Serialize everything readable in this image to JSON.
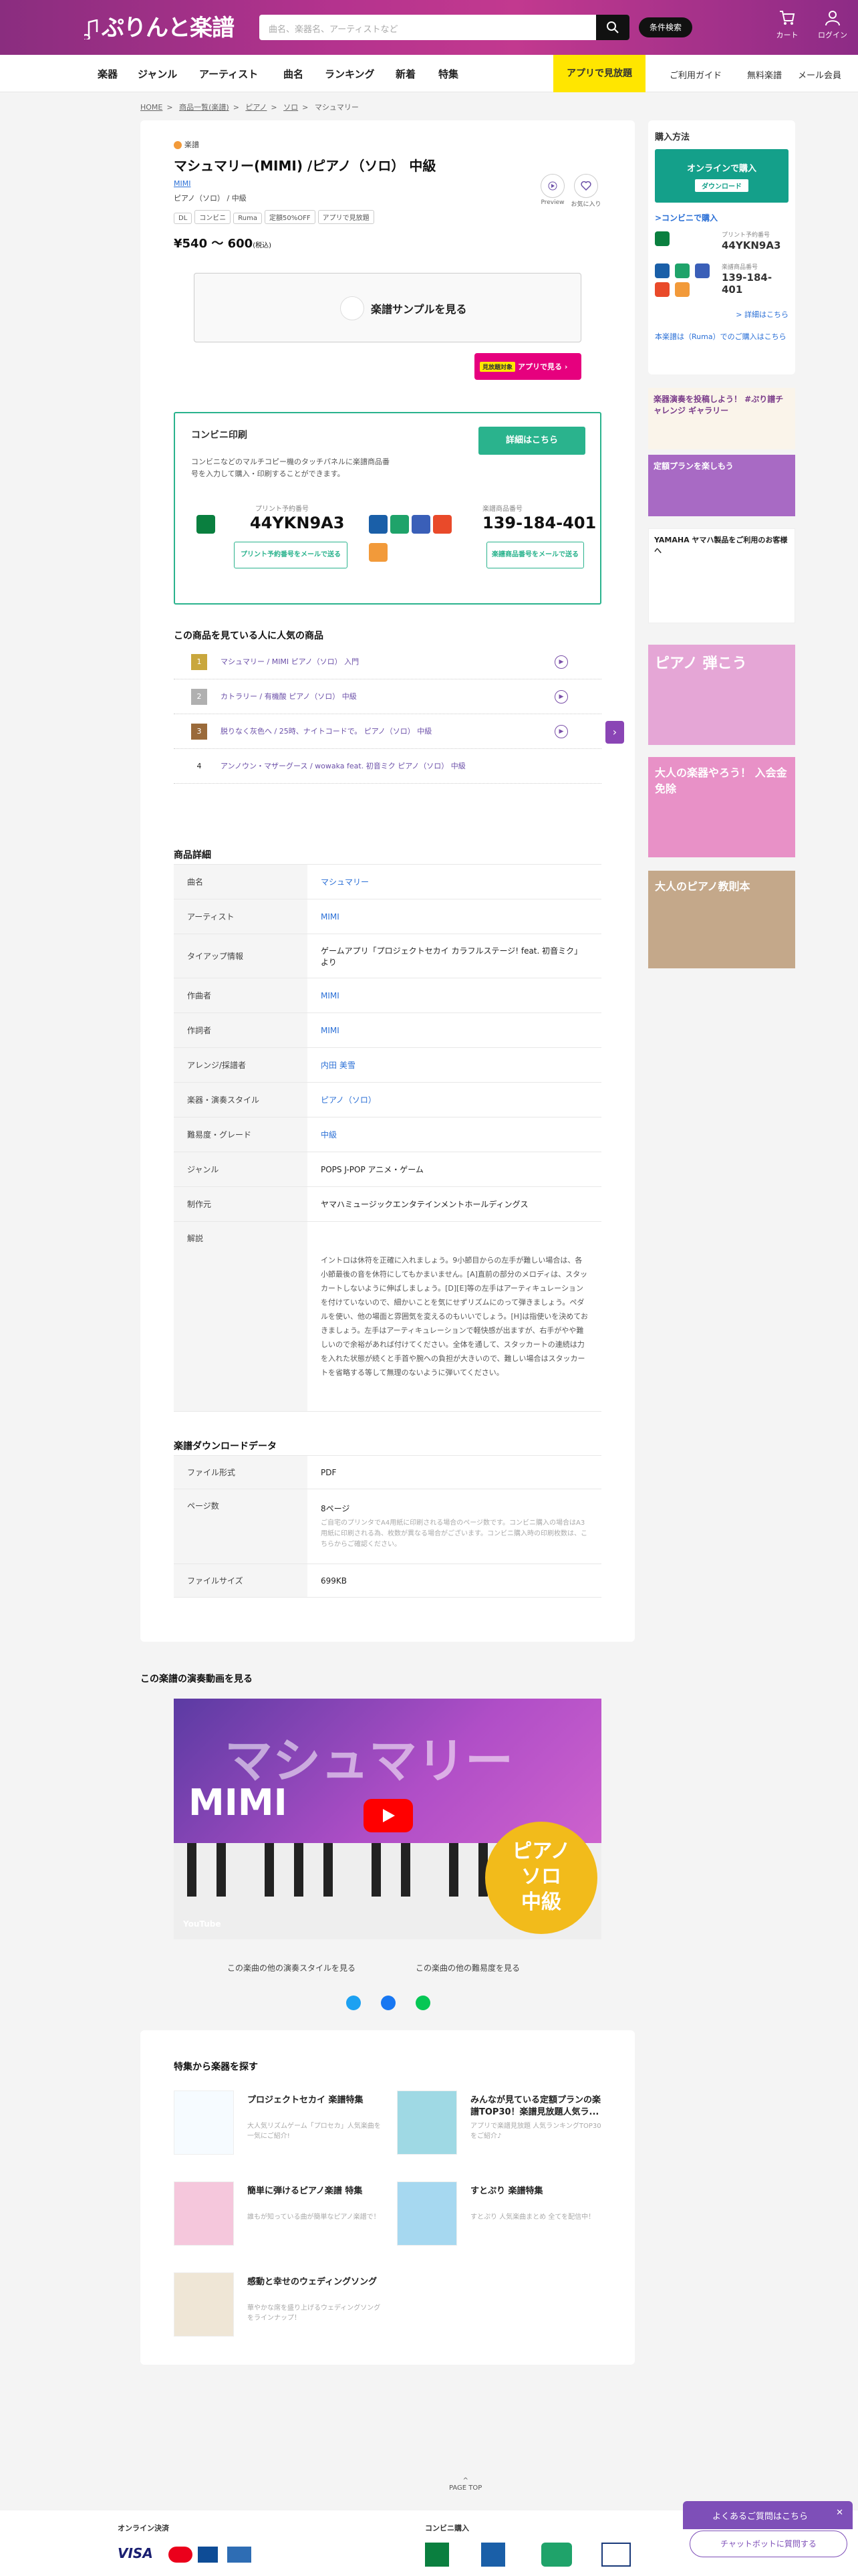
{
  "header": {
    "logo": "ぷりんと楽譜",
    "search_placeholder": "曲名、楽器名、アーティストなど",
    "condition_search": "条件検索",
    "cart": "カート",
    "login": "ログイン"
  },
  "nav": {
    "items": [
      "楽器",
      "ジャンル",
      "アーティスト",
      "曲名",
      "ランキング",
      "新着",
      "特集"
    ],
    "app": "アプリで見放題",
    "right": [
      "ご利用ガイド",
      "無料楽譜",
      "メール会員"
    ]
  },
  "breadcrumb": [
    "HOME",
    "商品一覧(楽譜)",
    "ピアノ",
    "ソロ",
    "マシュマリー"
  ],
  "product": {
    "category": "楽譜",
    "title": "マシュマリー(MIMI) /ピアノ（ソロ） 中級",
    "artist": "MIMI",
    "instrument": "ピアノ（ソロ） / 中級",
    "tags": [
      "DL",
      "コンビニ",
      "Ruma",
      "定額50%OFF",
      "アプリで見放題"
    ],
    "price": "¥540 〜 600",
    "tax": "(税込)",
    "favorite": "お気に入り",
    "preview": "Preview",
    "sample": "楽譜サンプルを見る",
    "app_badge": "見放題対象",
    "app_button": "アプリで見る"
  },
  "convenience": {
    "heading": "コンビニ印刷",
    "desc": "コンビニなどのマルチコピー機のタッチパネルに楽譜商品番号を入力して購入・印刷することができます。",
    "more": "詳細はこちら",
    "print_label": "プリント予約番号",
    "print_code": "44YKN9A3",
    "product_label": "楽譜商品番号",
    "product_code": "139-184-401",
    "mail1": "プリント予約番号をメールで送る",
    "mail2": "楽譜商品番号をメールで送る"
  },
  "popular": {
    "heading": "この商品を見ている人に人気の商品",
    "items": [
      {
        "rank": "1",
        "title": "マシュマリー / MIMI ピアノ（ソロ） 入門"
      },
      {
        "rank": "2",
        "title": "カトラリー / 有機酸 ピアノ（ソロ） 中級"
      },
      {
        "rank": "3",
        "title": "脱りなく灰色へ / 25時、ナイトコードで。 ピアノ（ソロ） 中級"
      },
      {
        "rank": "4",
        "title": "アンノウン・マザーグース / wowaka feat. 初音ミク ピアノ（ソロ） 中級"
      }
    ]
  },
  "details": {
    "heading": "商品詳細",
    "rows": [
      {
        "k": "曲名",
        "v": "マシュマリー"
      },
      {
        "k": "アーティスト",
        "v": "MIMI"
      },
      {
        "k": "タイアップ情報",
        "v": "ゲームアプリ「プロジェクトセカイ カラフルステージ! feat. 初音ミク」より"
      },
      {
        "k": "作曲者",
        "v": "MIMI"
      },
      {
        "k": "作詞者",
        "v": "MIMI"
      },
      {
        "k": "アレンジ/採譜者",
        "v": "内田 美雪"
      },
      {
        "k": "楽器・演奏スタイル",
        "v": "ピアノ（ソロ）"
      },
      {
        "k": "難易度・グレード",
        "v": "中級"
      },
      {
        "k": "ジャンル",
        "v": "POPS J-POP アニメ・ゲーム"
      },
      {
        "k": "制作元",
        "v": "ヤマハミュージックエンタテインメントホールディングス"
      },
      {
        "k": "解説",
        "v": "イントロは休符を正確に入れましょう。9小節目からの左手が難しい場合は、各小節最後の音を休符にしてもかまいません。[A]直前の部分のメロディは、スタッカートしないように伸ばしましょう。[D][E]等の左手はアーティキュレーションを付けていないので、細かいことを気にせずリズムにのって弾きましょう。ペダルを使い、他の場面と雰囲気を変えるのもいいでしょう。[H]は指使いを決めておきましょう。左手はアーティキュレーションで軽快感が出ますが、右手がやや難しいので余裕があれば付けてください。全体を通して、スタッカートの連続は力を入れた状態が続くと手首や腕への負担が大きいので、難しい場合はスタッカートを省略する等して無理のないように弾いてください。"
      }
    ]
  },
  "download": {
    "heading": "楽譜ダウンロードデータ",
    "rows": [
      {
        "k": "ファイル形式",
        "v": "PDF"
      },
      {
        "k": "ページ数",
        "v": "8ページ",
        "note": "ご自宅のプリンタでA4用紙に印刷される場合のページ数です。コンビニ購入の場合はA3用紙に印刷される為、枚数が異なる場合がございます。コンビニ購入時の印刷枚数は、こちらからご確認ください。"
      },
      {
        "k": "ファイルサイズ",
        "v": "699KB"
      }
    ]
  },
  "video": {
    "heading": "この楽譜の演奏動画を見る",
    "title": "マシュマリー",
    "artist": "MIMI",
    "badge": [
      "ピアノ",
      "ソロ",
      "中級"
    ],
    "channel": "YouTube",
    "link1": "この楽曲の他の演奏スタイルを見る",
    "link2": "この楽曲の他の難易度を見る"
  },
  "features": {
    "heading": "特集から楽器を探す",
    "items": [
      {
        "title": "プロジェクトセカイ 楽譜特集",
        "desc": "大人気リズムゲーム「プロセカ」人気楽曲を一気にご紹介!",
        "img": "プロジェクトセカイ"
      },
      {
        "title": "みんなが見ている定額プランの楽譜TOP30！楽譜見放題人気ラ...",
        "desc": "アプリで楽譜見放題 人気ランキングTOP30をご紹介♪",
        "img": "TOP30"
      },
      {
        "title": "簡単に弾けるピアノ楽譜 特集",
        "desc": "誰もが知っている曲が簡単なピアノ楽譜で！",
        "img": ""
      },
      {
        "title": "すとぷり 楽譜特集",
        "desc": "すとぷり 人気楽曲まとめ 全てを配信中！",
        "img": "すとぷり"
      },
      {
        "title": "感動と幸せのウェディングソング",
        "desc": "華やかな席を盛り上げるウェディングソングをラインナップ！",
        "img": ""
      }
    ]
  },
  "sidebar": {
    "purchase": "購入方法",
    "online": "オンラインで購入",
    "download": "ダウンロード",
    "conv_link": ">コンビニで購入",
    "print_label": "プリント予約番号",
    "print_code": "44YKN9A3",
    "product_label": "楽譜商品番号",
    "product_code": "139-184-401",
    "detail_link": "> 詳細はこちら",
    "ruma_link": "本楽譜は（Ruma）でのご購入はこちら"
  },
  "banners": [
    "楽器演奏を投稿しよう！ #ぷり譜チャレンジ ギャラリー",
    "定額プランを楽しもう",
    "YAMAHA ヤマハ製品をご利用のお客様へ",
    "ピアノ 弾こう",
    "大人の楽器やろう！ 入会金免除",
    "大人のピアノ教則本"
  ],
  "page_top": "PAGE TOP",
  "faq": "よくあるご質問はこちら",
  "chatbot": "チャットボットに質問する",
  "footer": {
    "online": "オンライン決済",
    "convenience": "コンビニ購入"
  }
}
